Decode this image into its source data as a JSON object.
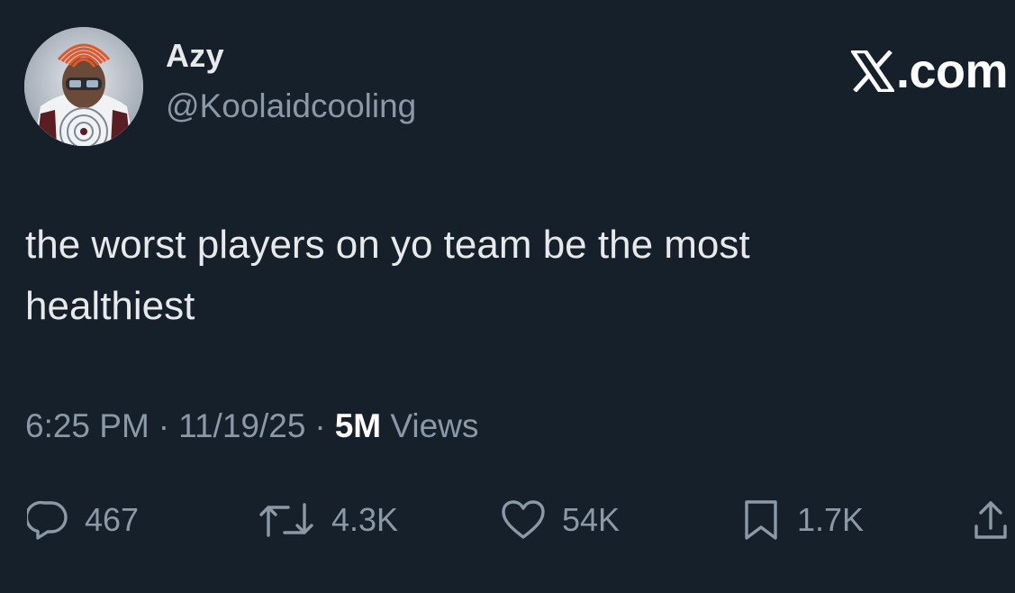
{
  "author": {
    "display_name": "Azy",
    "handle": "@Koolaidcooling"
  },
  "brand": {
    "label": ".com",
    "icon": "x-logo-icon"
  },
  "tweet": {
    "text": "the worst players on yo team be the most healthiest",
    "time": "6:25 PM",
    "date": "11/19/25",
    "separator": "·",
    "views_count": "5M",
    "views_label": "Views"
  },
  "actions": {
    "reply": {
      "icon": "reply-bubble-icon",
      "count": "467"
    },
    "retweet": {
      "icon": "retweet-arrows-icon",
      "count": "4.3K"
    },
    "like": {
      "icon": "heart-icon",
      "count": "54K"
    },
    "bookmark": {
      "icon": "bookmark-icon",
      "count": "1.7K"
    },
    "share": {
      "icon": "share-upload-icon"
    }
  },
  "colors": {
    "background": "#16202b",
    "primary_text": "#e7e9ea",
    "secondary_text": "#8b98a5",
    "brand_text": "#ffffff"
  }
}
